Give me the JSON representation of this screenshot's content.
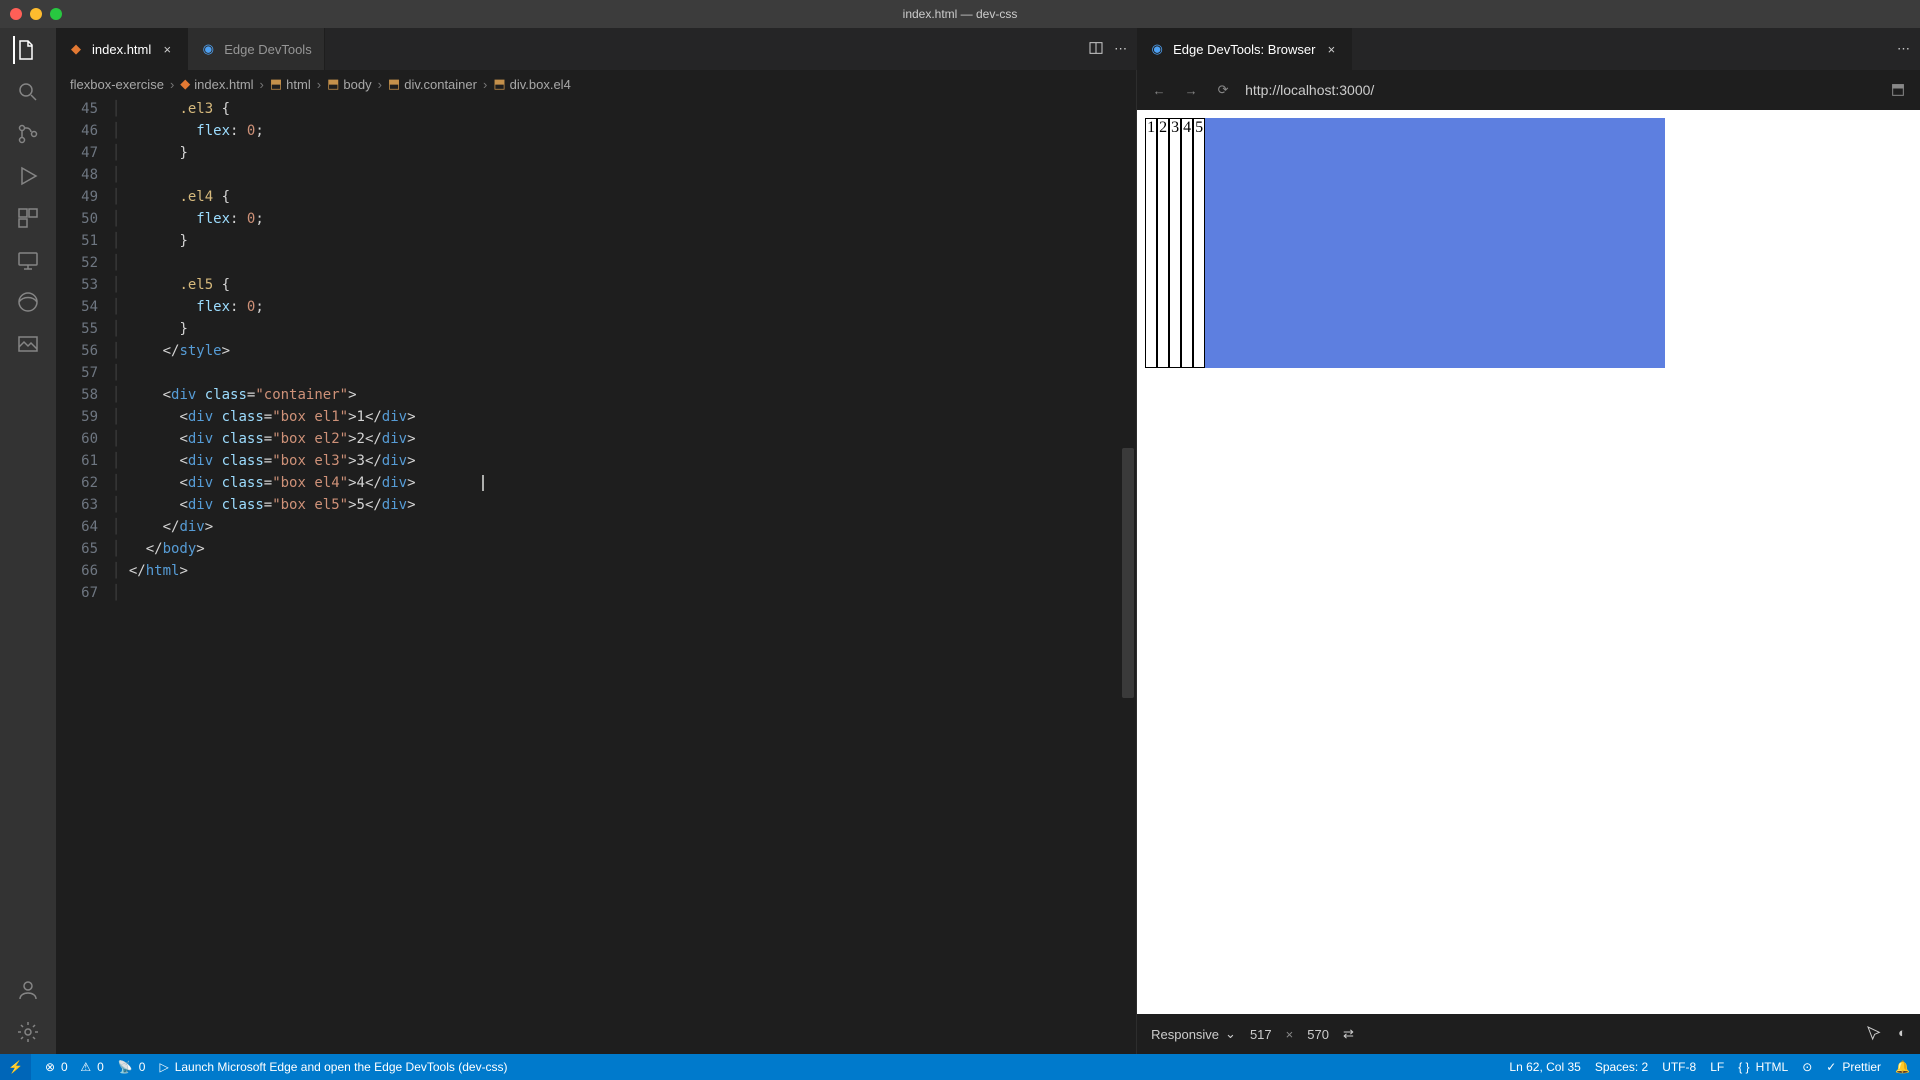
{
  "titlebar": {
    "title": "index.html — dev-css"
  },
  "activity": {
    "items": [
      "files-icon",
      "search-icon",
      "source-control-icon",
      "debug-icon",
      "extensions-icon",
      "remote-explorer-icon",
      "edge-icon",
      "gallery-icon"
    ],
    "bottom": [
      "account-icon",
      "settings-gear-icon"
    ]
  },
  "tabs": {
    "left": [
      {
        "label": "index.html",
        "active": true,
        "icon": "html-file-icon"
      },
      {
        "label": "Edge DevTools",
        "active": false,
        "icon": "edge-icon"
      }
    ],
    "right": [
      {
        "label": "Edge DevTools: Browser",
        "active": true,
        "icon": "edge-icon"
      }
    ]
  },
  "breadcrumbs": {
    "items": [
      "flexbox-exercise",
      "index.html",
      "html",
      "body",
      "div.container",
      "div.box.el4"
    ]
  },
  "code": {
    "lines": [
      {
        "n": 45,
        "html": "      <span class='tok-sel'>.el3</span> <span class='tok-brace'>{</span>"
      },
      {
        "n": 46,
        "html": "        <span class='tok-prop'>flex</span><span class='tok-punc'>:</span> <span class='tok-val'>0</span><span class='tok-punc'>;</span>"
      },
      {
        "n": 47,
        "html": "      <span class='tok-brace'>}</span>"
      },
      {
        "n": 48,
        "html": ""
      },
      {
        "n": 49,
        "html": "      <span class='tok-sel'>.el4</span> <span class='tok-brace'>{</span>"
      },
      {
        "n": 50,
        "html": "        <span class='tok-prop'>flex</span><span class='tok-punc'>:</span> <span class='tok-val'>0</span><span class='tok-punc'>;</span>"
      },
      {
        "n": 51,
        "html": "      <span class='tok-brace'>}</span>"
      },
      {
        "n": 52,
        "html": ""
      },
      {
        "n": 53,
        "html": "      <span class='tok-sel'>.el5</span> <span class='tok-brace'>{</span>"
      },
      {
        "n": 54,
        "html": "        <span class='tok-prop'>flex</span><span class='tok-punc'>:</span> <span class='tok-val'>0</span><span class='tok-punc'>;</span>"
      },
      {
        "n": 55,
        "html": "      <span class='tok-brace'>}</span>"
      },
      {
        "n": 56,
        "html": "    <span class='tok-punc'>&lt;/</span><span class='tok-tag'>style</span><span class='tok-punc'>&gt;</span>"
      },
      {
        "n": 57,
        "html": ""
      },
      {
        "n": 58,
        "html": "    <span class='tok-punc'>&lt;</span><span class='tok-tag'>div</span> <span class='tok-attr'>class</span>=<span class='tok-str'>\"container\"</span><span class='tok-punc'>&gt;</span>"
      },
      {
        "n": 59,
        "html": "      <span class='tok-punc'>&lt;</span><span class='tok-tag'>div</span> <span class='tok-attr'>class</span>=<span class='tok-str'>\"box el1\"</span><span class='tok-punc'>&gt;</span>1<span class='tok-punc'>&lt;/</span><span class='tok-tag'>div</span><span class='tok-punc'>&gt;</span>"
      },
      {
        "n": 60,
        "html": "      <span class='tok-punc'>&lt;</span><span class='tok-tag'>div</span> <span class='tok-attr'>class</span>=<span class='tok-str'>\"box el2\"</span><span class='tok-punc'>&gt;</span>2<span class='tok-punc'>&lt;/</span><span class='tok-tag'>div</span><span class='tok-punc'>&gt;</span>"
      },
      {
        "n": 61,
        "html": "      <span class='tok-punc'>&lt;</span><span class='tok-tag'>div</span> <span class='tok-attr'>class</span>=<span class='tok-str'>\"box el3\"</span><span class='tok-punc'>&gt;</span>3<span class='tok-punc'>&lt;/</span><span class='tok-tag'>div</span><span class='tok-punc'>&gt;</span>"
      },
      {
        "n": 62,
        "html": "      <span class='tok-punc'>&lt;</span><span class='tok-tag'>div</span> <span class='tok-attr'>class</span>=<span class='tok-str'>\"box el4\"</span><span class='tok-punc'>&gt;</span>4<span class='tok-punc'>&lt;/</span><span class='tok-tag'>div</span><span class='tok-punc'>&gt;</span>"
      },
      {
        "n": 63,
        "html": "      <span class='tok-punc'>&lt;</span><span class='tok-tag'>div</span> <span class='tok-attr'>class</span>=<span class='tok-str'>\"box el5\"</span><span class='tok-punc'>&gt;</span>5<span class='tok-punc'>&lt;/</span><span class='tok-tag'>div</span><span class='tok-punc'>&gt;</span>"
      },
      {
        "n": 64,
        "html": "    <span class='tok-punc'>&lt;/</span><span class='tok-tag'>div</span><span class='tok-punc'>&gt;</span>"
      },
      {
        "n": 65,
        "html": "  <span class='tok-punc'>&lt;/</span><span class='tok-tag'>body</span><span class='tok-punc'>&gt;</span>"
      },
      {
        "n": 66,
        "html": "<span class='tok-punc'>&lt;/</span><span class='tok-tag'>html</span><span class='tok-punc'>&gt;</span>"
      },
      {
        "n": 67,
        "html": ""
      }
    ],
    "cursor_line": 62
  },
  "browser": {
    "url": "http://localhost:3000/",
    "boxes": [
      "1",
      "2",
      "3",
      "4",
      "5"
    ]
  },
  "device": {
    "mode": "Responsive",
    "width": "517",
    "height": "570"
  },
  "status": {
    "errors": "0",
    "warnings": "0",
    "ports": "0",
    "launch": "Launch Microsoft Edge and open the Edge DevTools (dev-css)",
    "position": "Ln 62, Col 35",
    "spaces": "Spaces: 2",
    "encoding": "UTF-8",
    "eol": "LF",
    "lang": "HTML",
    "prettier": "Prettier"
  }
}
